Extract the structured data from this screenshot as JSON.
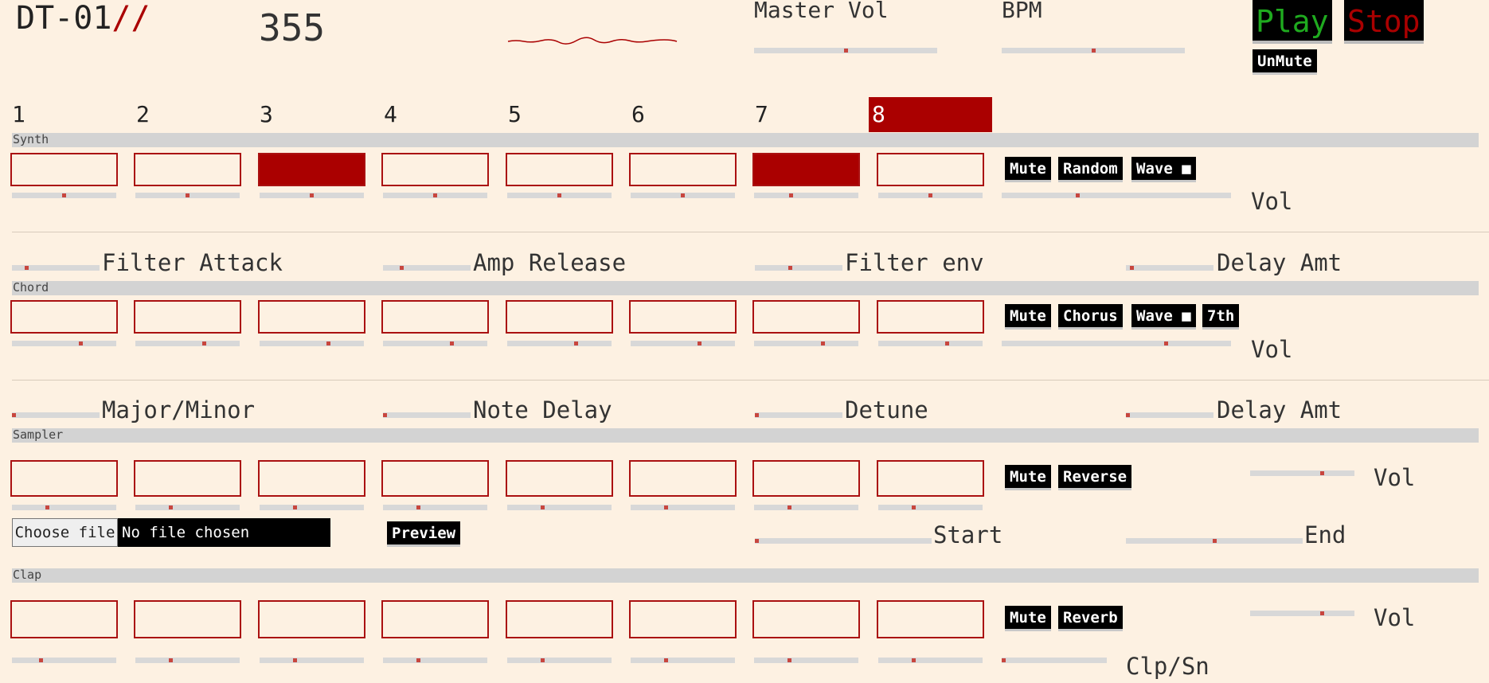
{
  "header": {
    "logo_text": "DT-01",
    "logo_slashes": "//",
    "counter": "355",
    "master_vol": {
      "label": "Master Vol",
      "value": 0.5
    },
    "bpm": {
      "label": "BPM",
      "value": 0.5
    },
    "play_label": "Play",
    "stop_label": "Stop",
    "unmute_label": "UnMute",
    "colors": {
      "play": "#1faa1f",
      "stop": "#aa0000",
      "accent": "#aa0000"
    }
  },
  "steps": {
    "labels": [
      "1",
      "2",
      "3",
      "4",
      "5",
      "6",
      "7",
      "8"
    ],
    "active": 8
  },
  "synth": {
    "title": "Synth",
    "pads_on": [
      false,
      false,
      true,
      false,
      false,
      false,
      true,
      false
    ],
    "pad_sliders": [
      0.5,
      0.5,
      0.5,
      0.5,
      0.5,
      0.5,
      0.35,
      0.5
    ],
    "buttons": {
      "mute": "Mute",
      "random": "Random",
      "wave": "Wave ■"
    },
    "vol": {
      "label": "Vol",
      "value": 0.33
    },
    "knobs": [
      {
        "label": "Filter Attack",
        "value": 0.15
      },
      {
        "label": "Amp Release",
        "value": 0.2
      },
      {
        "label": "Filter env",
        "value": 0.4
      },
      {
        "label": "Delay Amt",
        "value": 0.05
      }
    ]
  },
  "chord": {
    "title": "Chord",
    "pads_on": [
      false,
      false,
      false,
      false,
      false,
      false,
      false,
      false
    ],
    "pad_sliders": [
      0.67,
      0.67,
      0.67,
      0.67,
      0.67,
      0.67,
      0.67,
      0.67
    ],
    "buttons": {
      "mute": "Mute",
      "chorus": "Chorus",
      "wave": "Wave ■",
      "seventh": "7th"
    },
    "vol": {
      "label": "Vol",
      "value": 0.72
    },
    "knobs": [
      {
        "label": "Major/Minor",
        "value": 0.0
      },
      {
        "label": "Note Delay",
        "value": 0.0
      },
      {
        "label": "Detune",
        "value": 0.0
      },
      {
        "label": "Delay Amt",
        "value": 0.0
      }
    ]
  },
  "sampler": {
    "title": "Sampler",
    "pads_on": [
      false,
      false,
      false,
      false,
      false,
      false,
      false,
      false
    ],
    "pad_sliders": [
      0.33,
      0.33,
      0.33,
      0.33,
      0.33,
      0.33,
      0.33,
      0.33
    ],
    "buttons": {
      "mute": "Mute",
      "reverse": "Reverse",
      "preview": "Preview"
    },
    "vol": {
      "label": "Vol",
      "value": 0.7
    },
    "file": {
      "button": "Choose file",
      "status": "No file chosen"
    },
    "start": {
      "label": "Start",
      "value": 0.0
    },
    "end": {
      "label": "End",
      "value": 0.5
    }
  },
  "clap": {
    "title": "Clap",
    "pads_on": [
      false,
      false,
      false,
      false,
      false,
      false,
      false,
      false
    ],
    "pad_sliders": [
      0.27,
      0.33,
      0.33,
      0.33,
      0.33,
      0.33,
      0.33,
      0.33
    ],
    "buttons": {
      "mute": "Mute",
      "reverb": "Reverb"
    },
    "vol": {
      "label": "Vol",
      "value": 0.7
    },
    "clap_snare": {
      "label": "Clp/Sn",
      "value": 0.0
    }
  }
}
